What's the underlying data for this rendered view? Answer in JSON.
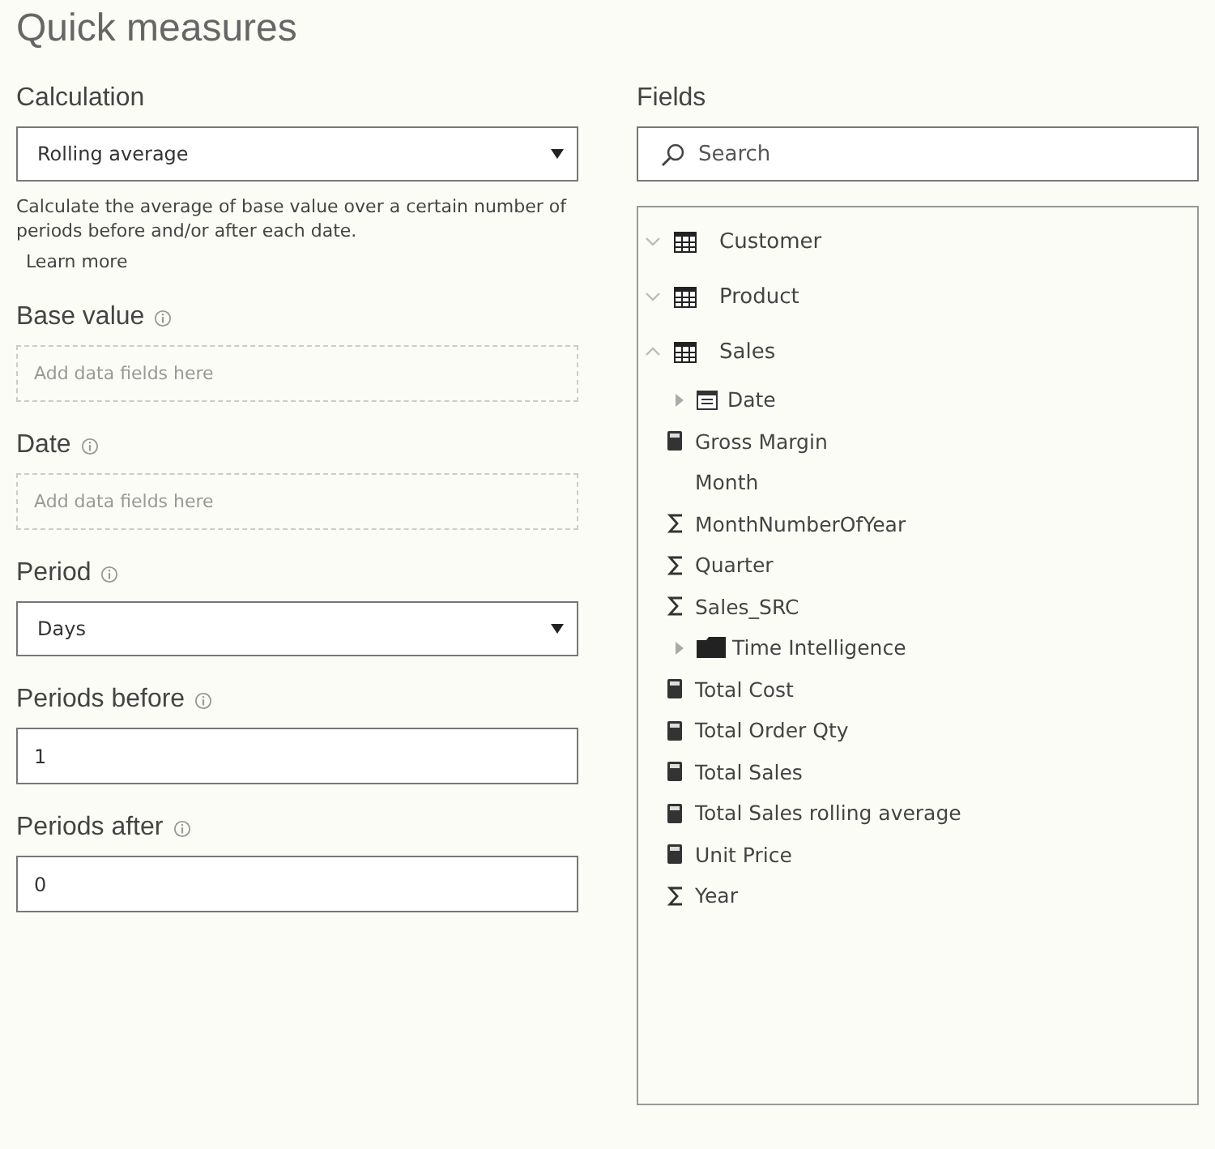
{
  "title": "Quick measures",
  "settings": [
    {
      "kind": "select",
      "label": "Calculation",
      "info": false,
      "value": "Rolling average",
      "description": "Calculate the average of base value over a certain number of periods before and/or after each date.",
      "link": "Learn more"
    },
    {
      "kind": "drop",
      "label": "Base value",
      "info": true,
      "placeholder": "Add data fields here"
    },
    {
      "kind": "drop",
      "label": "Date",
      "info": true,
      "placeholder": "Add data fields here"
    },
    {
      "kind": "select",
      "label": "Period",
      "info": true,
      "value": "Days"
    },
    {
      "kind": "number",
      "label": "Periods before",
      "info": true,
      "value": "1"
    },
    {
      "kind": "number",
      "label": "Periods after",
      "info": true,
      "value": "0"
    }
  ],
  "fields": {
    "label": "Fields",
    "search": {
      "placeholder": "Search"
    },
    "tables": [
      {
        "name": "Customer",
        "expanded": false
      },
      {
        "name": "Product",
        "expanded": false
      },
      {
        "name": "Sales",
        "expanded": true,
        "children": [
          {
            "name": "Date",
            "kind": "hierarchy",
            "expanded": false
          },
          {
            "name": "Gross Margin",
            "kind": "measure"
          },
          {
            "name": "Month",
            "kind": "plain"
          },
          {
            "name": "MonthNumberOfYear",
            "kind": "sum"
          },
          {
            "name": "Quarter",
            "kind": "sum"
          },
          {
            "name": "Sales_SRC",
            "kind": "sum"
          },
          {
            "name": "Time Intelligence",
            "kind": "folder",
            "expanded": false
          },
          {
            "name": "Total Cost",
            "kind": "measure"
          },
          {
            "name": "Total Order Qty",
            "kind": "measure"
          },
          {
            "name": "Total Sales",
            "kind": "measure"
          },
          {
            "name": "Total Sales rolling average",
            "kind": "measure"
          },
          {
            "name": "Unit Price",
            "kind": "measure"
          },
          {
            "name": "Year",
            "kind": "sum"
          }
        ]
      }
    ]
  }
}
